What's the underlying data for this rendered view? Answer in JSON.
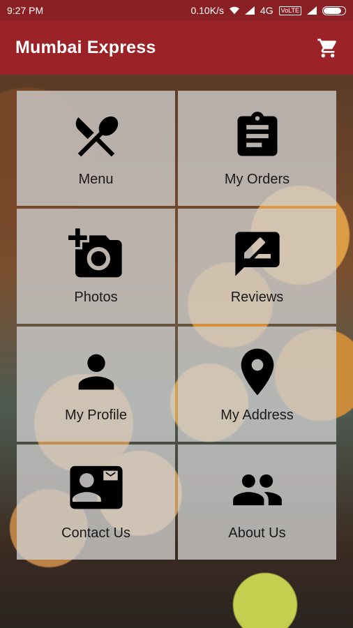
{
  "status_bar": {
    "time": "9:27 PM",
    "speed": "0.10K/s",
    "network": "4G",
    "volte": "VoLTE"
  },
  "app_bar": {
    "title": "Mumbai Express",
    "cart_icon": "cart-icon"
  },
  "colors": {
    "status_bar": "#8a1f24",
    "app_bar": "#9b2226",
    "tile_bg": "rgba(208,208,208,0.78)"
  },
  "tiles": [
    {
      "label": "Menu",
      "icon": "fork-spoon-icon"
    },
    {
      "label": "My Orders",
      "icon": "clipboard-icon"
    },
    {
      "label": "Photos",
      "icon": "add-camera-icon"
    },
    {
      "label": "Reviews",
      "icon": "rate-review-icon"
    },
    {
      "label": "My Profile",
      "icon": "person-icon"
    },
    {
      "label": "My Address",
      "icon": "location-pin-icon"
    },
    {
      "label": "Contact Us",
      "icon": "contact-card-icon"
    },
    {
      "label": "About Us",
      "icon": "people-icon"
    }
  ]
}
